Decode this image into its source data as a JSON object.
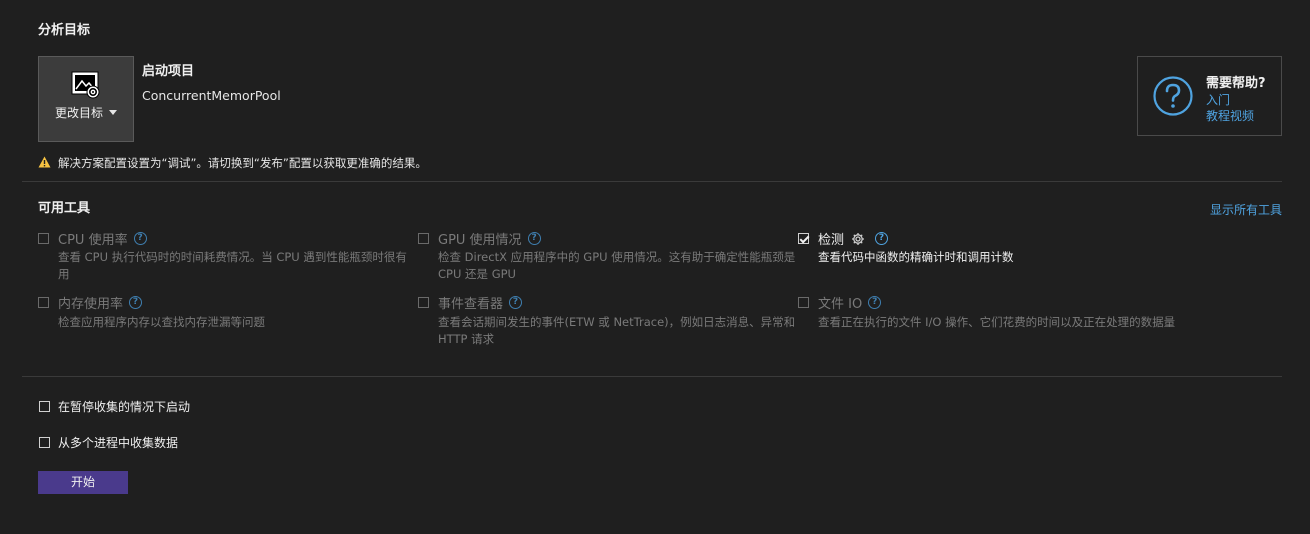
{
  "analysis_target": {
    "section_title": "分析目标",
    "change_target_label": "更改目标",
    "startup_label": "启动项目",
    "project_name": "ConcurrentMemorPool",
    "warning": "解决方案配置设置为“调试”。请切换到“发布”配置以获取更准确的结果。"
  },
  "help": {
    "title": "需要帮助?",
    "link_intro": "入门",
    "link_videos": "教程视频"
  },
  "tools": {
    "section_title": "可用工具",
    "show_all": "显示所有工具",
    "items": [
      {
        "name": "CPU 使用率",
        "desc": "查看 CPU 执行代码时的时间耗费情况。当 CPU 遇到性能瓶颈时很有用",
        "checked": false,
        "enabled": false
      },
      {
        "name": "GPU 使用情况",
        "desc": "检查 DirectX 应用程序中的 GPU 使用情况。这有助于确定性能瓶颈是 CPU 还是 GPU",
        "checked": false,
        "enabled": false
      },
      {
        "name": "检测",
        "desc": "查看代码中函数的精确计时和调用计数",
        "checked": true,
        "enabled": true
      },
      {
        "name": "内存使用率",
        "desc": "检查应用程序内存以查找内存泄漏等问题",
        "checked": false,
        "enabled": false
      },
      {
        "name": "事件查看器",
        "desc": "查看会话期间发生的事件(ETW 或 NetTrace)，例如日志消息、异常和 HTTP 请求",
        "checked": false,
        "enabled": false
      },
      {
        "name": "文件 IO",
        "desc": "查看正在执行的文件 I/O 操作、它们花费的时间以及正在处理的数据量",
        "checked": false,
        "enabled": false
      }
    ]
  },
  "options": {
    "start_paused": "在暂停收集的情况下启动",
    "multi_process": "从多个进程中收集数据"
  },
  "start_button": "开始",
  "colors": {
    "background": "#1f1f1f",
    "accent_link": "#4fa3e0",
    "start_button": "#4a3a8c",
    "warning": "#f5c242"
  }
}
